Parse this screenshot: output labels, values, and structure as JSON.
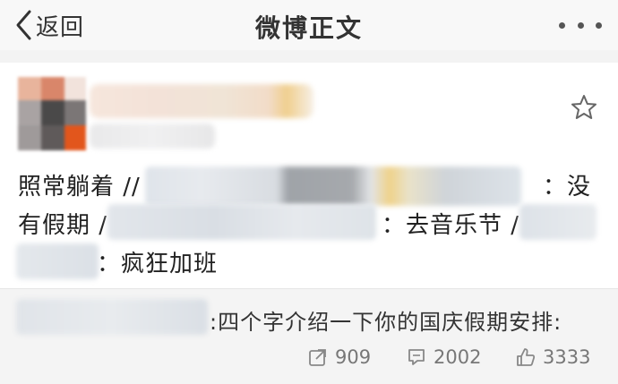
{
  "nav": {
    "back_label": "返回",
    "title": "微博正文",
    "more_icon": "more-horizontal-icon"
  },
  "post": {
    "favorite_icon": "star-outline-icon",
    "line1_start": "照常躺着 //",
    "line1_end": "：没",
    "line2_start": "有假期 /",
    "line2_mid": "：去音乐节 /",
    "line3_end": "：疯狂加班"
  },
  "repost": {
    "text": ":四个字介绍一下你的国庆假期安排:",
    "repost_count": "909",
    "comment_count": "2002",
    "like_count": "3333"
  },
  "colors": {
    "navbar_bg": "#f8f8f8",
    "repost_bg": "#f4f4f4",
    "text": "#222222",
    "meta_text": "#777777"
  }
}
